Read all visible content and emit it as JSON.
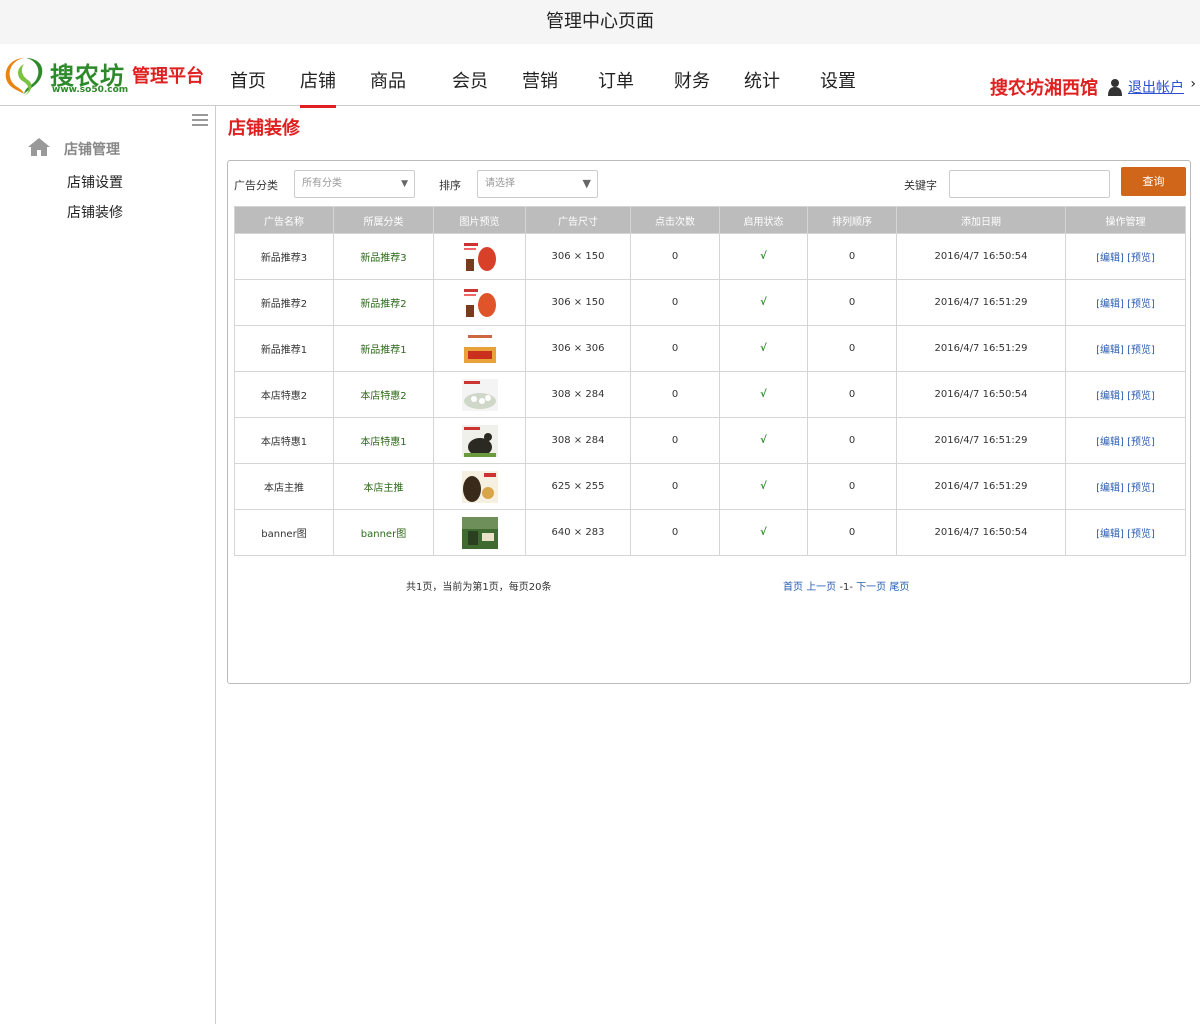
{
  "topbar": {
    "title": "管理中心页面"
  },
  "header": {
    "brand": "搜农坊",
    "brand_url": "www.so50.com",
    "platform": "管理平台",
    "nav": [
      "首页",
      "店铺",
      "商品",
      "会员",
      "营销",
      "订单",
      "财务",
      "统计",
      "设置"
    ],
    "active_nav": "店铺",
    "shop_name": "搜农坊湘西馆",
    "logout": "退出帐户"
  },
  "sidebar": {
    "section": "店铺管理",
    "links": [
      "店铺设置",
      "店铺装修"
    ]
  },
  "main": {
    "page_title": "店铺装修",
    "filters": {
      "category_label": "广告分类",
      "category_value": "所有分类",
      "sort_label": "排序",
      "sort_value": "请选择",
      "keyword_label": "关键字",
      "search_button": "查询"
    },
    "table": {
      "headers": [
        "广告名称",
        "所属分类",
        "图片预览",
        "广告尺寸",
        "点击次数",
        "启用状态",
        "排列顺序",
        "添加日期",
        "操作管理"
      ],
      "rows": [
        {
          "name": "新品推荐3",
          "category": "新品推荐3",
          "size": "306 × 150",
          "clicks": "0",
          "status": "√",
          "order": "0",
          "date": "2016/4/7 16:50:54",
          "edit": "[编辑]",
          "preview": "[预览]"
        },
        {
          "name": "新品推荐2",
          "category": "新品推荐2",
          "size": "306 × 150",
          "clicks": "0",
          "status": "√",
          "order": "0",
          "date": "2016/4/7 16:51:29",
          "edit": "[编辑]",
          "preview": "[预览]"
        },
        {
          "name": "新品推荐1",
          "category": "新品推荐1",
          "size": "306 × 306",
          "clicks": "0",
          "status": "√",
          "order": "0",
          "date": "2016/4/7 16:51:29",
          "edit": "[编辑]",
          "preview": "[预览]"
        },
        {
          "name": "本店特惠2",
          "category": "本店特惠2",
          "size": "308 × 284",
          "clicks": "0",
          "status": "√",
          "order": "0",
          "date": "2016/4/7 16:50:54",
          "edit": "[编辑]",
          "preview": "[预览]"
        },
        {
          "name": "本店特惠1",
          "category": "本店特惠1",
          "size": "308 × 284",
          "clicks": "0",
          "status": "√",
          "order": "0",
          "date": "2016/4/7 16:51:29",
          "edit": "[编辑]",
          "preview": "[预览]"
        },
        {
          "name": "本店主推",
          "category": "本店主推",
          "size": "625 × 255",
          "clicks": "0",
          "status": "√",
          "order": "0",
          "date": "2016/4/7 16:51:29",
          "edit": "[编辑]",
          "preview": "[预览]"
        },
        {
          "name": "banner图",
          "category": "banner图",
          "size": "640 × 283",
          "clicks": "0",
          "status": "√",
          "order": "0",
          "date": "2016/4/7 16:50:54",
          "edit": "[编辑]",
          "preview": "[预览]"
        }
      ]
    },
    "pager": {
      "info": "共1页，当前为第1页，每页20条",
      "first": "首页",
      "prev": "上一页",
      "current": "-1-",
      "next": "下一页",
      "last": "尾页"
    }
  },
  "colors": {
    "accent": "#e02020",
    "brand_green": "#2d8a2a",
    "button": "#d0661a",
    "header_row": "#bcbcbc",
    "link": "#2a5db0"
  }
}
